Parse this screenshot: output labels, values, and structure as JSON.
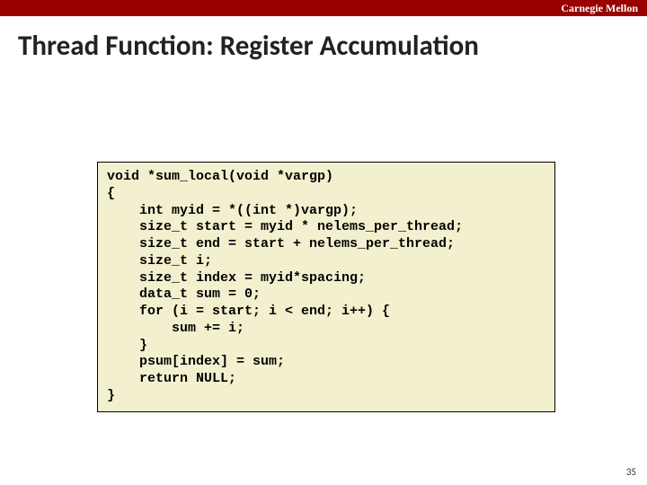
{
  "brand": "Carnegie Mellon",
  "title": "Thread Function: Register Accumulation",
  "code": {
    "l1": "void *sum_local(void *vargp)",
    "l2": "{",
    "l3": "    int myid = *((int *)vargp);",
    "l4": "    size_t start = myid * nelems_per_thread;",
    "l5": "    size_t end = start + nelems_per_thread;",
    "l6": "    size_t i;",
    "l7": "    size_t index = myid*spacing;",
    "l8": "    data_t sum = 0;",
    "l9": "    for (i = start; i < end; i++) {",
    "l10": "        sum += i;",
    "l11": "    }",
    "l12": "    psum[index] = sum;",
    "l13": "    return NULL;",
    "l14": "}"
  },
  "page_number": "35"
}
